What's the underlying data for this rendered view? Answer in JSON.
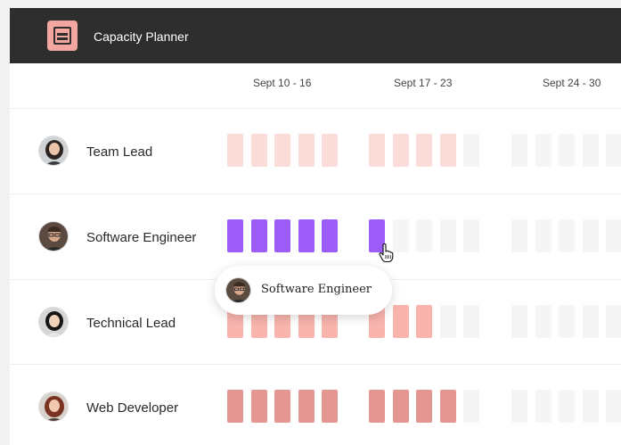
{
  "app": {
    "title": "Capacity Planner",
    "logo_icon": "calendar-list-icon",
    "colors": {
      "topbar": "#2e2e2e",
      "logo": "#f4a7a1"
    }
  },
  "weeks": [
    "Sept 10 - 16",
    "Sept 17 - 23",
    "Sept 24 - 30"
  ],
  "rows": [
    {
      "role": "Team Lead",
      "avatar": "avatar-woman-dark-hair",
      "color": "#fbdcd9",
      "booked_days": [
        5,
        4,
        0
      ]
    },
    {
      "role": "Software Engineer",
      "avatar": "avatar-man-glasses",
      "color": "#9b5cf8",
      "booked_days": [
        5,
        1,
        0
      ]
    },
    {
      "role": "Technical Lead",
      "avatar": "avatar-woman-black-hair",
      "color": "#f8b4ad",
      "booked_days": [
        5,
        3,
        0
      ]
    },
    {
      "role": "Web Developer",
      "avatar": "avatar-woman-red-hair",
      "color": "#e39790",
      "booked_days": [
        5,
        4,
        0
      ]
    }
  ],
  "empty_cell_color": "#f5f5f5",
  "tooltip": {
    "label": "Software Engineer",
    "avatar": "avatar-man-glasses"
  },
  "cursor": "hand-pointer-icon"
}
